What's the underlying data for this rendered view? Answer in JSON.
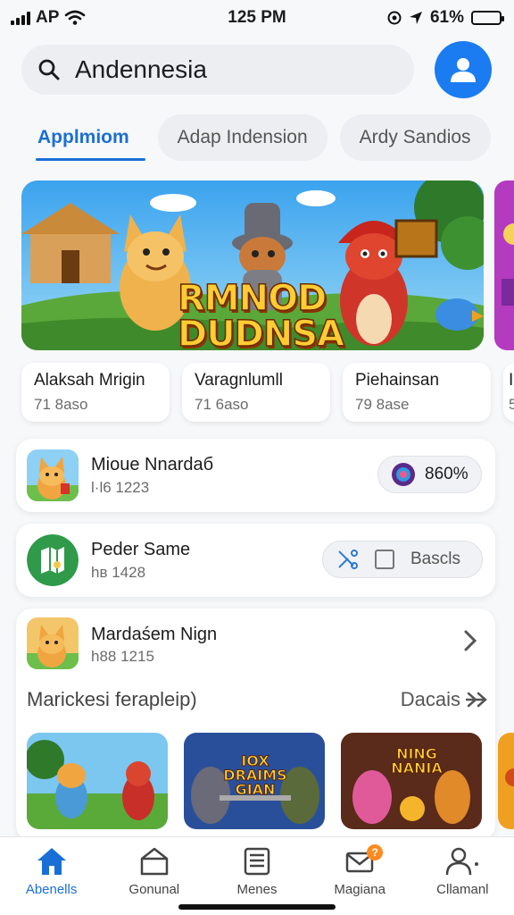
{
  "status_bar": {
    "carrier": "AP",
    "time": "125 PM",
    "battery": "61%",
    "battery_level": 0.61
  },
  "search": {
    "value": "Andennesia"
  },
  "tabs": [
    {
      "label": "Applmiom",
      "active": true
    },
    {
      "label": "Adap Indension",
      "active": false
    },
    {
      "label": "Ardy Sandios",
      "active": false
    }
  ],
  "banner": {
    "title_line1": "RMNOD",
    "title_line2": "DUDNSA"
  },
  "cards": [
    {
      "title": "Alaksah Mrigin",
      "sub": "71 8aso"
    },
    {
      "title": "Varagnlumll",
      "sub": "71 6aso"
    },
    {
      "title": "Piehainsan",
      "sub": "79 8ase"
    },
    {
      "title": "I",
      "sub": "5"
    }
  ],
  "list": [
    {
      "name": "Mioue Nnardaб",
      "meta": "l·l6 1223",
      "pill": "860%"
    },
    {
      "name": "Peder Same",
      "meta": "hв 1428",
      "pill": "Bascls"
    },
    {
      "name": "Mardaśem Nign",
      "meta": "h88 1215"
    }
  ],
  "section": {
    "title": "Marickesi ferapleip)",
    "more": "Dacais"
  },
  "thumbs": [
    {
      "text": ""
    },
    {
      "text": "IOX DRAIMS GIAN"
    },
    {
      "text": "NING NANIA"
    },
    {
      "text": ""
    }
  ],
  "nav": [
    {
      "label": "Abenells",
      "active": true
    },
    {
      "label": "Gonunal",
      "active": false
    },
    {
      "label": "Menes",
      "active": false
    },
    {
      "label": "Magiana",
      "active": false,
      "badge": "?"
    },
    {
      "label": "Cllamanl",
      "active": false
    }
  ],
  "colors": {
    "accent": "#1a6fd6",
    "avatar": "#1a7cf0",
    "battery": "#34c759",
    "badge": "#ff8a1f"
  }
}
